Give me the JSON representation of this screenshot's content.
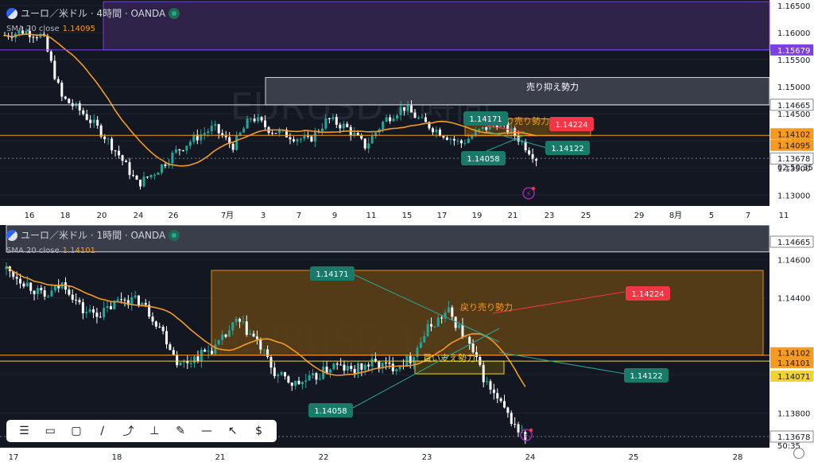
{
  "top_panel": {
    "title": "ユーロ／米ドル · 4時間 · OANDA",
    "sma_label": "SMA 20 close",
    "sma_value": "1.14095",
    "watermark": "EURUSD 4時間",
    "zones": [
      {
        "label": "売り抑え勢力",
        "color": "#ffffff"
      },
      {
        "label": "戻り売り勢力",
        "color": "#f59a23"
      }
    ],
    "callouts": [
      "1.14171",
      "1.14224",
      "1.14058",
      "1.14122"
    ],
    "price_ticks": [
      "1.16500",
      "1.16000",
      "1.15500",
      "1.15000",
      "1.14500",
      "1.14000",
      "1.13500",
      "1.13000"
    ],
    "price_badges": [
      {
        "text": "1.15679",
        "bg": "#7b3fe4"
      },
      {
        "text": "1.14665",
        "bg": "#ffffff"
      },
      {
        "text": "1.14102",
        "bg": "#f59a23"
      },
      {
        "text": "1.14095",
        "bg": "#f59a23"
      },
      {
        "text": "1.13678",
        "bg": "#ffffff"
      }
    ],
    "countdown": "02:50:35",
    "time_ticks": [
      "16",
      "18",
      "20",
      "24",
      "26",
      "7月",
      "3",
      "7",
      "9",
      "11",
      "15",
      "17",
      "19",
      "21",
      "23",
      "25",
      "29",
      "8月",
      "5",
      "7",
      "11"
    ]
  },
  "bottom_panel": {
    "title": "ユーロ／米ドル · 1時間 · OANDA",
    "sma_label": "SMA 20 close",
    "sma_value": "1.14101",
    "watermark": "EURUSD 1時間",
    "zones": [
      {
        "label": "戻り売り勢力",
        "color": "#f59a23"
      },
      {
        "label": "買い支え勢力",
        "color": "#f2d22e"
      }
    ],
    "callouts": [
      "1.14171",
      "1.14224",
      "1.14058",
      "1.14122"
    ],
    "price_ticks": [
      "1.14600",
      "1.14400",
      "1.14000",
      "1.13800"
    ],
    "price_badges": [
      {
        "text": "1.14665",
        "bg": "#ffffff"
      },
      {
        "text": "1.14102",
        "bg": "#f59a23"
      },
      {
        "text": "1.14101",
        "bg": "#f59a23"
      },
      {
        "text": "1.14071",
        "bg": "#f2d22e"
      },
      {
        "text": "1.13678",
        "bg": "#ffffff"
      }
    ],
    "countdown": "50:35",
    "time_ticks": [
      "17",
      "18",
      "21",
      "22",
      "23",
      "24",
      "25",
      "28"
    ]
  },
  "toolbar": {
    "icons": [
      "lines-icon",
      "comment-icon",
      "rectangle-icon",
      "trend-line-icon",
      "path-icon",
      "position-icon",
      "brush-icon",
      "horizontal-line-icon",
      "cursor-icon",
      "price-tag-icon"
    ]
  },
  "chart_data": [
    {
      "type": "candlestick",
      "title": "ユーロ／米ドル · 4時間 · OANDA",
      "ylim": [
        1.128,
        1.166
      ],
      "x": [
        "16",
        "18",
        "20",
        "24",
        "26",
        "7月",
        "3",
        "7",
        "9",
        "11",
        "15",
        "17",
        "19",
        "21",
        "23",
        "25",
        "29",
        "8月",
        "5",
        "7",
        "11"
      ],
      "series": [
        {
          "name": "SMA 20 close",
          "value_last": 1.14095,
          "color": "#f59a23"
        }
      ],
      "close_path": [
        1.1595,
        1.1603,
        1.1593,
        1.148,
        1.1455,
        1.142,
        1.1375,
        1.132,
        1.1345,
        1.138,
        1.1405,
        1.1425,
        1.139,
        1.1445,
        1.142,
        1.141,
        1.14,
        1.144,
        1.1425,
        1.139,
        1.1438,
        1.1463,
        1.1435,
        1.1415,
        1.1395,
        1.1418,
        1.1435,
        1.1407,
        1.1368
      ],
      "levels": [
        1.15679,
        1.14665,
        1.14102,
        1.14095,
        1.13678
      ]
    },
    {
      "type": "candlestick",
      "title": "ユーロ／米ドル · 1時間 · OANDA",
      "ylim": [
        1.1362,
        1.1478
      ],
      "x": [
        "17",
        "18",
        "21",
        "22",
        "23",
        "24",
        "25",
        "28"
      ],
      "series": [
        {
          "name": "SMA 20 close",
          "value_last": 1.14101,
          "color": "#f59a23"
        }
      ],
      "close_path": [
        1.1455,
        1.1448,
        1.144,
        1.1448,
        1.1433,
        1.1432,
        1.144,
        1.1438,
        1.1425,
        1.1405,
        1.141,
        1.1415,
        1.1428,
        1.1418,
        1.14,
        1.1395,
        1.1398,
        1.1405,
        1.1402,
        1.1406,
        1.1404,
        1.1408,
        1.1425,
        1.1433,
        1.1417,
        1.1395,
        1.138,
        1.1366
      ],
      "levels": [
        1.14665,
        1.14102,
        1.14101,
        1.14071,
        1.13678
      ]
    }
  ]
}
